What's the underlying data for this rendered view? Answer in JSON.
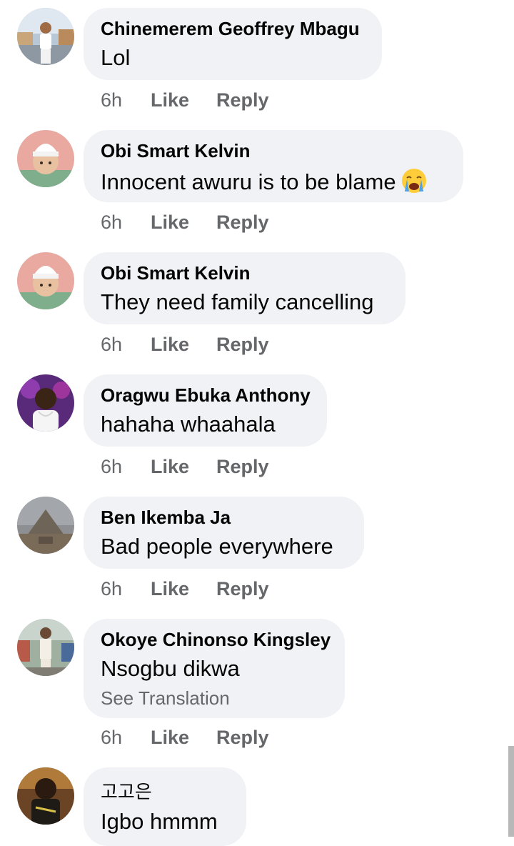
{
  "comments": [
    {
      "author": "Chinemerem Geoffrey Mbagu",
      "text": "Lol",
      "time": "6h",
      "like": "Like",
      "reply": "Reply"
    },
    {
      "author": "Obi Smart Kelvin",
      "text": "Innocent awuru is to be blame",
      "emoji": "crying-face",
      "time": "6h",
      "like": "Like",
      "reply": "Reply"
    },
    {
      "author": "Obi Smart Kelvin",
      "text": "They need family cancelling",
      "time": "6h",
      "like": "Like",
      "reply": "Reply"
    },
    {
      "author": "Oragwu Ebuka Anthony",
      "text": "hahaha whaahala",
      "time": "6h",
      "like": "Like",
      "reply": "Reply"
    },
    {
      "author": "Ben Ikemba Ja",
      "text": "Bad people everywhere",
      "time": "6h",
      "like": "Like",
      "reply": "Reply"
    },
    {
      "author": "Okoye Chinonso Kingsley",
      "text": "Nsogbu dikwa",
      "see_translation": "See Translation",
      "time": "6h",
      "like": "Like",
      "reply": "Reply"
    },
    {
      "author": "고고은",
      "text": "Igbo hmmm"
    }
  ],
  "colors": {
    "bubble": "#f0f2f5",
    "secondary_text": "#65676b",
    "primary_text": "#050505"
  }
}
